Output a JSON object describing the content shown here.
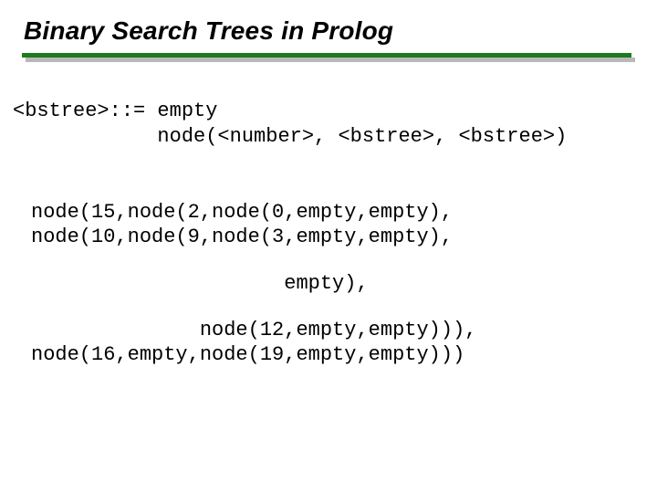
{
  "title": "Binary Search Trees in Prolog",
  "grammar": {
    "l1": "<bstree>::= empty",
    "l2": "            node(<number>, <bstree>, <bstree>)"
  },
  "code": {
    "b1l1": "node(15,node(2,node(0,empty,empty),",
    "b1l2": "node(10,node(9,node(3,empty,empty),",
    "b2l1": "                     empty),",
    "b3l1": "              node(12,empty,empty))),",
    "b3l2": "node(16,empty,node(19,empty,empty)))"
  }
}
